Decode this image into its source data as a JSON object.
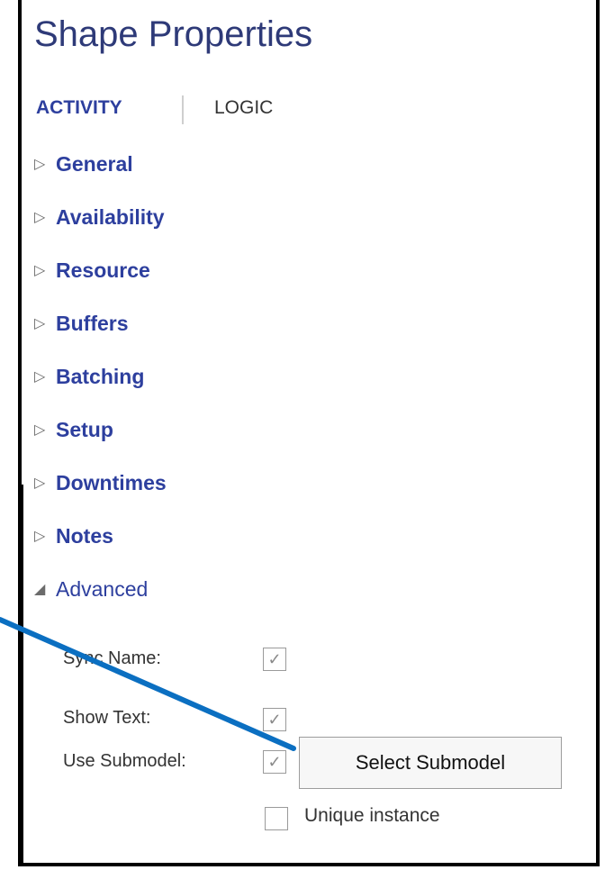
{
  "panel": {
    "title": "Shape Properties",
    "tabs": [
      {
        "label": "ACTIVITY",
        "active": true
      },
      {
        "label": "LOGIC",
        "active": false
      }
    ],
    "sections": [
      {
        "label": "General",
        "expanded": false
      },
      {
        "label": "Availability",
        "expanded": false
      },
      {
        "label": "Resource",
        "expanded": false
      },
      {
        "label": "Buffers",
        "expanded": false
      },
      {
        "label": "Batching",
        "expanded": false
      },
      {
        "label": "Setup",
        "expanded": false
      },
      {
        "label": "Downtimes",
        "expanded": false
      },
      {
        "label": "Notes",
        "expanded": false
      },
      {
        "label": "Advanced",
        "expanded": true
      }
    ],
    "collapsed_glyph": "▷",
    "expanded_glyph": "◢"
  },
  "advanced": {
    "sync_name_label": "Sync Name:",
    "sync_name_checked": true,
    "show_text_label": "Show Text:",
    "show_text_checked": true,
    "use_submodel_label": "Use Submodel:",
    "use_submodel_checked": true,
    "select_submodel_button": "Select Submodel",
    "unique_instance_label": "Unique instance",
    "unique_instance_checked": false,
    "check_glyph": "✓"
  },
  "colors": {
    "accent": "#2d3f9e",
    "callout_line": "#0b6fc1"
  }
}
